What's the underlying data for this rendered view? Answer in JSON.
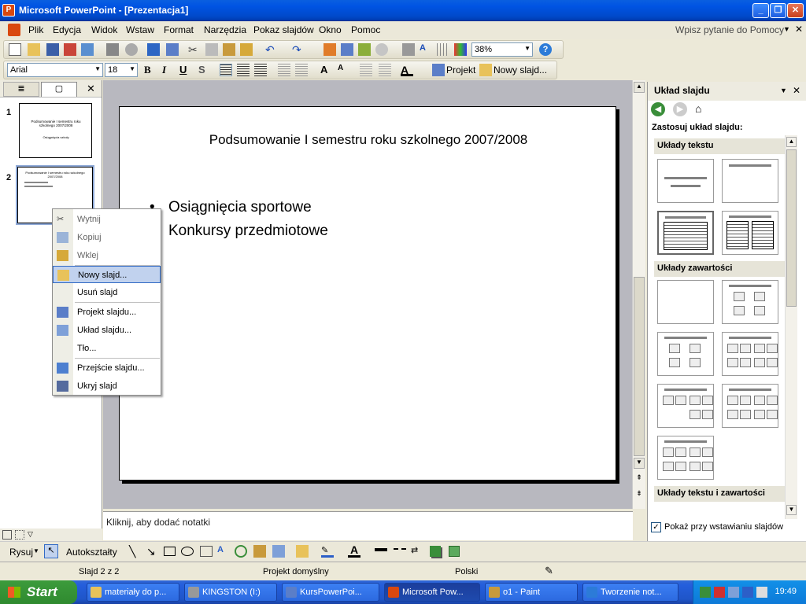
{
  "window": {
    "title": "Microsoft PowerPoint - [Prezentacja1]"
  },
  "menu": {
    "items": [
      "Plik",
      "Edycja",
      "Widok",
      "Wstaw",
      "Format",
      "Narzędzia",
      "Pokaz slajdów",
      "Okno",
      "Pomoc"
    ],
    "help_placeholder": "Wpisz pytanie do Pomocy"
  },
  "toolbar": {
    "zoom": "38%",
    "font": "Arial",
    "size": "18",
    "bold": "B",
    "italic": "I",
    "underline": "U",
    "shadow": "S",
    "projekt": "Projekt",
    "nowy_slajd": "Nowy slajd..."
  },
  "thumbnails": [
    {
      "num": "1",
      "title": "Podsumowanie I semestru roku szkolnego 2007/2008",
      "sub": "Osiągnięcia szkoły"
    },
    {
      "num": "2",
      "title": "Podsumowanie I semestru roku szkolnego 2007/2008",
      "sub": ""
    }
  ],
  "slide": {
    "title": "Podsumowanie I semestru roku szkolnego 2007/2008",
    "bullets": [
      "Osiągnięcia sportowe",
      "Konkursy przedmiotowe"
    ]
  },
  "notes": {
    "placeholder": "Kliknij, aby dodać notatki"
  },
  "context_menu": {
    "items": [
      "Wytnij",
      "Kopiuj",
      "Wklej",
      "Nowy slajd...",
      "Usuń slajd",
      "Projekt slajdu...",
      "Układ slajdu...",
      "Tło...",
      "Przejście slajdu...",
      "Ukryj slajd"
    ],
    "highlighted": "Nowy slajd..."
  },
  "task_pane": {
    "title": "Układ slajdu",
    "apply_label": "Zastosuj układ slajdu:",
    "sections": [
      "Układy tekstu",
      "Układy zawartości",
      "Układy tekstu i zawartości"
    ],
    "show_on_insert": "Pokaż przy wstawianiu slajdów"
  },
  "drawing": {
    "draw": "Rysuj",
    "autoshapes": "Autokształty"
  },
  "status": {
    "slide": "Slajd 2 z 2",
    "design": "Projekt domyślny",
    "language": "Polski"
  },
  "taskbar": {
    "start": "Start",
    "tasks": [
      "materiały do p...",
      "KINGSTON (I:)",
      "KursPowerPoi...",
      "Microsoft Pow...",
      "o1 - Paint",
      "Tworzenie not..."
    ],
    "clock": "19:49"
  },
  "colors": {
    "title_blue": "#0054E3",
    "taskbar_blue": "#245EDC",
    "start_green": "#3C9B3C",
    "highlight": "#C1D2EE"
  }
}
